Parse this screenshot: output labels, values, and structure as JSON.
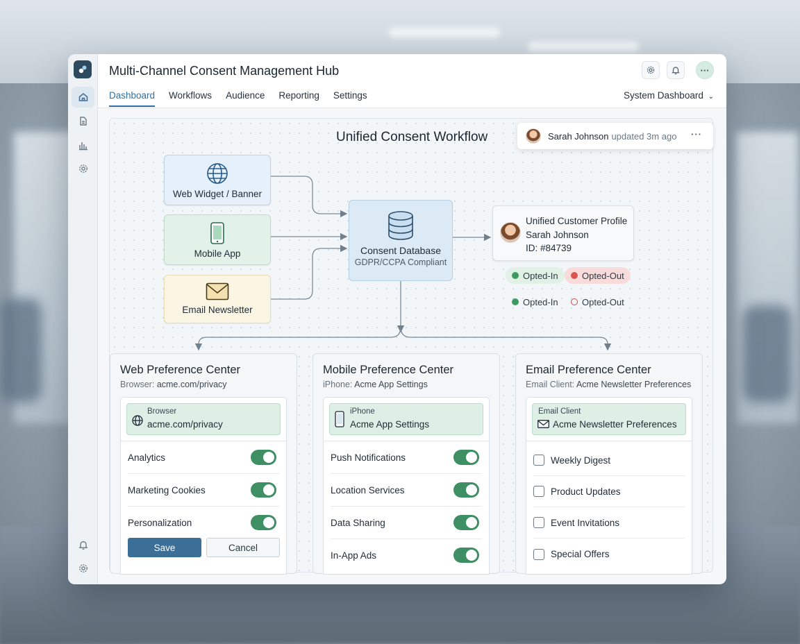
{
  "app": {
    "title": "Multi-Channel Consent Management Hub",
    "nav_tabs": [
      "Dashboard",
      "Workflows",
      "Audience",
      "Reporting",
      "Settings"
    ],
    "active_tab": "Dashboard",
    "view_selector": "System Dashboard"
  },
  "header_icons": [
    "gear-icon",
    "bell-icon",
    "more-icon"
  ],
  "rail_icons": [
    "app-logo",
    "home-icon",
    "documents-icon",
    "bar-chart-icon",
    "gear-icon",
    "bell-icon",
    "gear-icon"
  ],
  "workflow": {
    "title": "Unified Consent Workflow",
    "activity": {
      "who": "Sarah Johnson",
      "what": "updated 3m ago"
    },
    "sources": [
      {
        "label": "Web Widget / Banner",
        "icon": "globe-icon"
      },
      {
        "label": "Mobile App",
        "icon": "phone-icon"
      },
      {
        "label": "Email Newsletter",
        "icon": "envelope-icon"
      }
    ],
    "database": {
      "label": "Consent Database",
      "sublabel": "GDPR/CCPA Compliant",
      "icon": "database-icon"
    },
    "profile": {
      "title": "Unified Customer Profile",
      "name": "Sarah Johnson",
      "id": "ID: #84739"
    },
    "status_legend": [
      {
        "label": "Opted-In",
        "style": "filled"
      },
      {
        "label": "Opted-Out",
        "style": "filled"
      },
      {
        "label": "Opted-In",
        "style": "plain"
      },
      {
        "label": "Opted-Out",
        "style": "outline"
      }
    ]
  },
  "cards": {
    "web": {
      "title": "Web Preference Center",
      "sub_key": "Browser:",
      "sub_val": "acme.com/privacy",
      "addr_key": "Browser",
      "addr_val": "acme.com/privacy",
      "rows": [
        {
          "label": "Analytics",
          "on": true
        },
        {
          "label": "Marketing Cookies",
          "on": true
        },
        {
          "label": "Personalization",
          "on": true
        }
      ],
      "save_label": "Save",
      "cancel_label": "Cancel"
    },
    "mobile": {
      "title": "Mobile Preference Center",
      "sub_key": "iPhone:",
      "sub_val": "Acme App Settings",
      "addr_key": "iPhone",
      "addr_val": "Acme App Settings",
      "rows": [
        {
          "label": "Push Notifications",
          "on": true
        },
        {
          "label": "Location Services",
          "on": true
        },
        {
          "label": "Data Sharing",
          "on": true
        },
        {
          "label": "In-App Ads",
          "on": true
        }
      ]
    },
    "email": {
      "title": "Email Preference Center",
      "sub_key": "Email Client:",
      "sub_val": "Acme Newsletter Preferences",
      "addr_key": "Email Client",
      "addr_val": "Acme Newsletter Preferences",
      "rows": [
        {
          "label": "Weekly Digest",
          "checked": false
        },
        {
          "label": "Product Updates",
          "checked": false
        },
        {
          "label": "Event Invitations",
          "checked": false
        },
        {
          "label": "Special Offers",
          "checked": false
        }
      ]
    }
  },
  "colors": {
    "accent": "#2f6fa3",
    "toggle_on": "#3f8f64",
    "opted_in": "#3f9a62",
    "opted_out": "#d9544f",
    "save_button": "#3c6f97"
  }
}
